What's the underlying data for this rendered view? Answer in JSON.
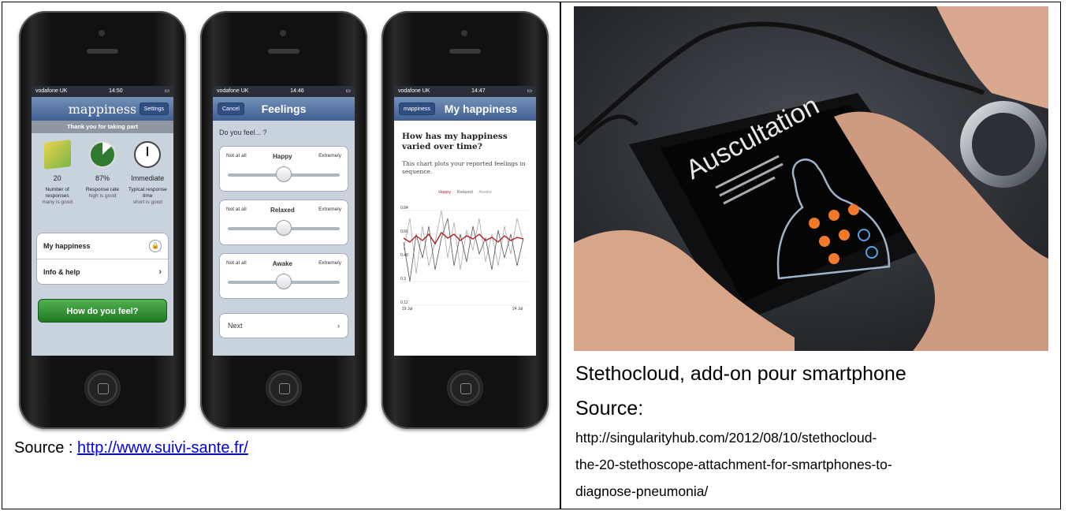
{
  "left": {
    "phones": {
      "phone1": {
        "status_carrier": "vodafone UK",
        "status_time": "14:50",
        "app_title": "mappiness",
        "settings_label": "Settings",
        "banner": "Thank you for taking part",
        "stats": [
          {
            "value": "20",
            "label": "Number of responses",
            "sub": "many is good"
          },
          {
            "value": "87%",
            "label": "Response rate",
            "sub": "high is good"
          },
          {
            "value": "Immediate",
            "label": "Typical response time",
            "sub": "short is good"
          }
        ],
        "menu_my_happiness": "My happiness",
        "menu_info": "Info & help",
        "cta_label": "How do you feel?"
      },
      "phone2": {
        "status_carrier": "vodafone UK",
        "status_time": "14:46",
        "cancel_label": "Cancel",
        "title": "Feelings",
        "question": "Do you feel... ?",
        "sliders": [
          {
            "min": "Not at all",
            "name": "Happy",
            "max": "Extremely",
            "level": 0.5
          },
          {
            "min": "Not at all",
            "name": "Relaxed",
            "max": "Extremely",
            "level": 0.5
          },
          {
            "min": "Not at all",
            "name": "Awake",
            "max": "Extremely",
            "level": 0.5
          }
        ],
        "next_label": "Next"
      },
      "phone3": {
        "status_carrier": "vodafone UK",
        "status_time": "14:47",
        "back_label": "mappiness",
        "title": "My happiness",
        "heading": "How has my happiness varied over time?",
        "description": "This chart plots your reported feelings in sequence.",
        "legend": [
          "Happy",
          "Relaxed",
          "Awake"
        ],
        "y_ticks": [
          "0.84",
          "0.66",
          "0.48",
          "0.3",
          "0.12"
        ],
        "x_start": "19 Jul",
        "x_end": "24 Jul"
      }
    },
    "source_prefix": "Source : ",
    "source_link": "http://www.suivi-sante.fr/"
  },
  "right": {
    "phone_screen_title": "Auscultation",
    "caption_line1": "Stethocloud, add-on pour smartphone",
    "caption_line2": "Source:",
    "url_lines": [
      "http://singularityhub.com/2012/08/10/stethocloud-",
      "the-20-stethoscope-attachment-for-smartphones-to-",
      "diagnose-pneumonia/"
    ]
  },
  "colors": {
    "link": "#0000ee",
    "nav_blue": "#3f5f93",
    "cta_green": "#1f7a23",
    "happy_series": "#b0202a"
  }
}
